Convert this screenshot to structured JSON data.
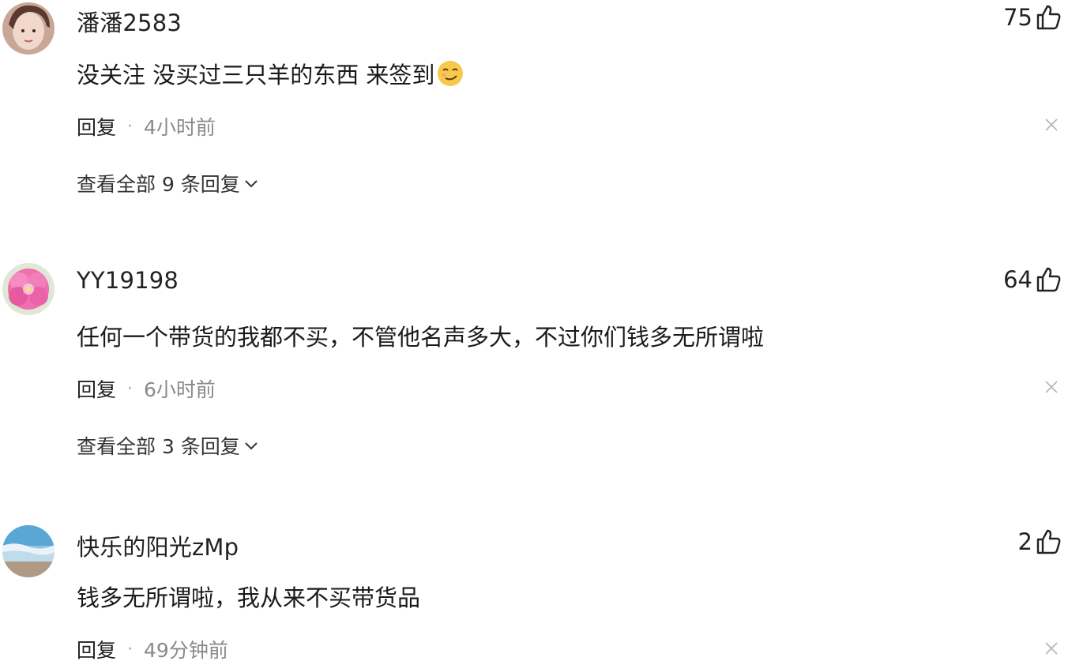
{
  "comments": [
    {
      "username": "潘潘2583",
      "likes": "75",
      "text": "没关注 没买过三只羊的东西 来签到",
      "reply_label": "回复",
      "separator": "·",
      "time": "4小时前",
      "expand_label": "查看全部 9 条回复",
      "avatar_icon": "avatar-photo-person",
      "emoji_icon": "smirk-emoji"
    },
    {
      "username": "YY19198",
      "likes": "64",
      "text": "任何一个带货的我都不买，不管他名声多大，不过你们钱多无所谓啦",
      "reply_label": "回复",
      "separator": "·",
      "time": "6小时前",
      "expand_label": "查看全部 3 条回复",
      "avatar_icon": "avatar-pink-flower"
    },
    {
      "username": "快乐的阳光zMp",
      "likes": "2",
      "text": "钱多无所谓啦，我从来不买带货品",
      "reply_label": "回复",
      "separator": "·",
      "time": "49分钟前",
      "avatar_icon": "avatar-beach"
    }
  ],
  "colors": {
    "text": "#222222",
    "time": "#8a8a8a",
    "background": "#ffffff"
  }
}
